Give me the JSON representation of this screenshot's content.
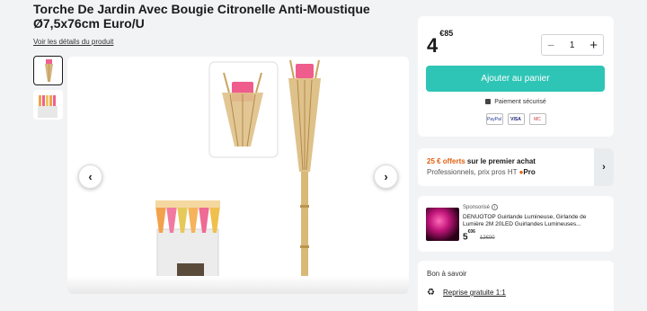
{
  "product": {
    "title": "Torche De Jardin Avec Bougie Citronelle Anti-Moustique Ø7,5x76cm Euro/U",
    "details_link": "Voir les détails du produit"
  },
  "gallery": {
    "prev_icon": "‹",
    "next_icon": "›"
  },
  "buy_box": {
    "price_int": "4",
    "price_dec": "€85",
    "quantity": "1",
    "add_to_cart": "Ajouter au panier",
    "secure_payment": "Paiement sécurisé",
    "payment_methods": [
      "PayPal",
      "VISA",
      "MC"
    ]
  },
  "pro_offer": {
    "amount": "25 € offerts",
    "line1_rest": " sur le premier achat",
    "line2": "Professionnels, prix pros HT ",
    "pro_label": "Pro"
  },
  "sponsored": {
    "tag": "Sponsorisé",
    "text": "DENUOTOP Guirlande Lumineuse, Girlande de Lumière 2M 20LED Guirlandes Lumineuses...",
    "price_int": "5",
    "price_dec": "€06",
    "old_price": "12€00"
  },
  "good_to_know": {
    "heading": "Bon à savoir",
    "returns": "Reprise gratuite 1:1"
  },
  "colors": {
    "accent": "#2ec5b6",
    "pro_orange": "#e06010"
  }
}
